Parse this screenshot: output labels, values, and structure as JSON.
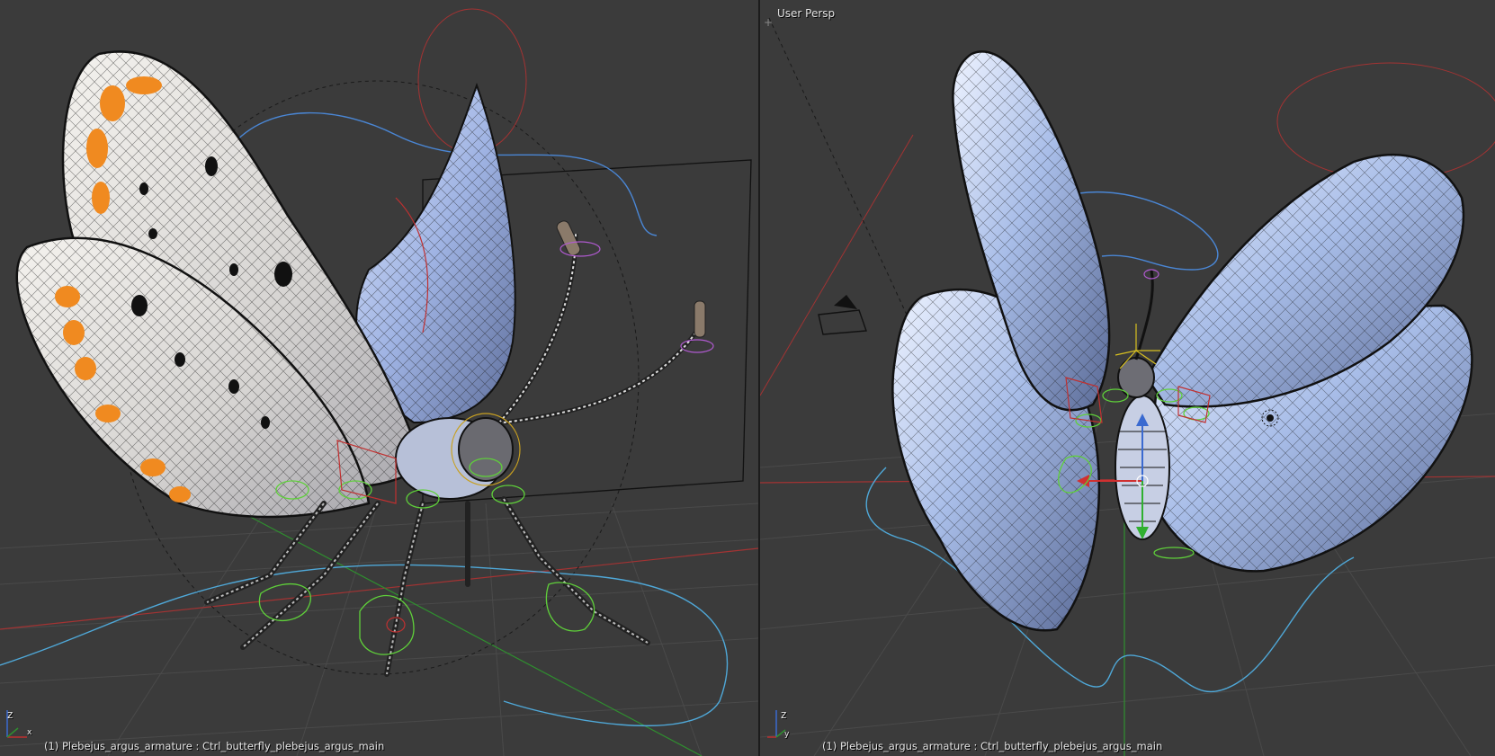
{
  "viewports": {
    "left": {
      "status": "(1) Plebejus_argus_armature : Ctrl_butterfly_plebejus_argus_main"
    },
    "right": {
      "view_name": "User Persp",
      "status": "(1) Plebejus_argus_armature : Ctrl_butterfly_plebejus_argus_main"
    }
  },
  "axes": {
    "x": "x",
    "y": "y",
    "z": "z"
  },
  "icons": {
    "corner_widget": "plus-icon"
  },
  "colors": {
    "background": "#3b3b3b",
    "grid": "#4a4a4a",
    "x_axis": "#a33333",
    "y_axis": "#2f8f2f",
    "wing_blue": "#a8bde8",
    "wing_white": "#e8e4e0",
    "spot_orange": "#f08a20",
    "control_cyan": "#4fa8d8",
    "control_green": "#5fd03a",
    "control_red": "#c03030"
  }
}
